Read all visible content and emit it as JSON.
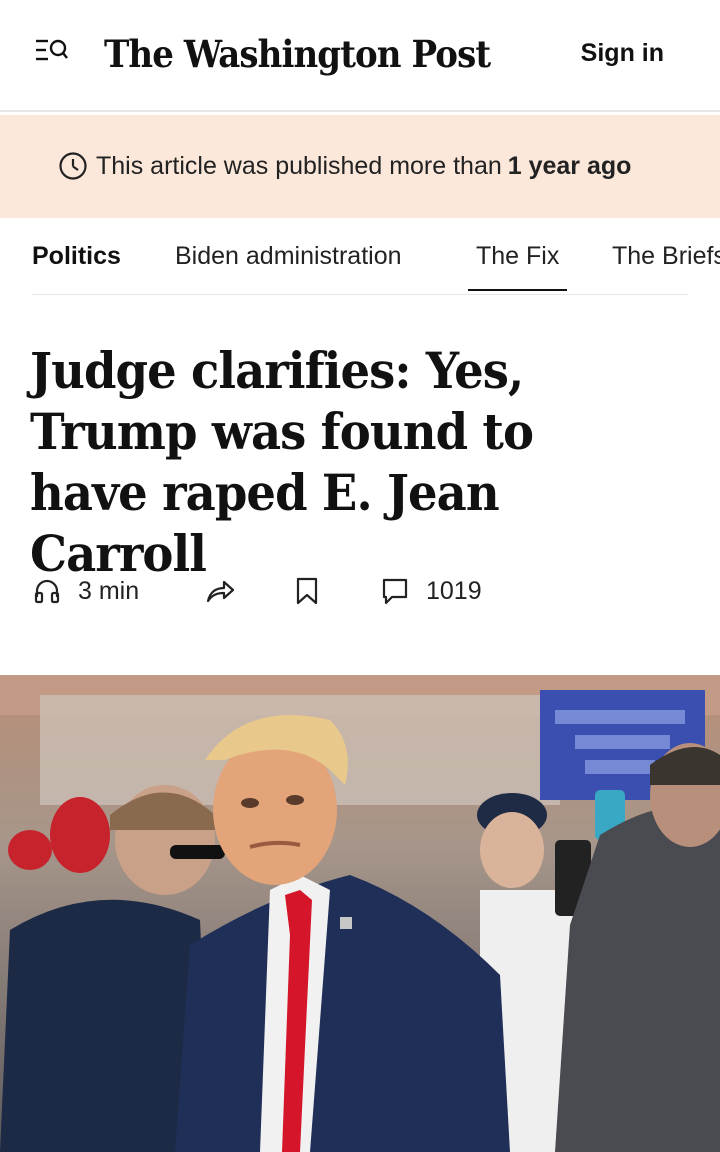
{
  "header": {
    "menu_icon": "search-menu-icon",
    "logo": "The Washington Post",
    "sign_in": "Sign in"
  },
  "banner": {
    "icon": "clock-icon",
    "text": "This article was published more than",
    "emphasis": "1 year ago"
  },
  "nav": {
    "items": [
      {
        "label": "Politics"
      },
      {
        "label": "Biden administration"
      },
      {
        "label": "The Fix"
      },
      {
        "label": "The Briefs"
      }
    ]
  },
  "article": {
    "headline": "Judge clarifies: Yes, Trump was found to have raped E. Jean Carroll",
    "listen_time": "3 min",
    "comment_count": "1019",
    "icons": [
      "headphones-icon",
      "share-icon",
      "bookmark-icon",
      "comment-icon"
    ]
  }
}
